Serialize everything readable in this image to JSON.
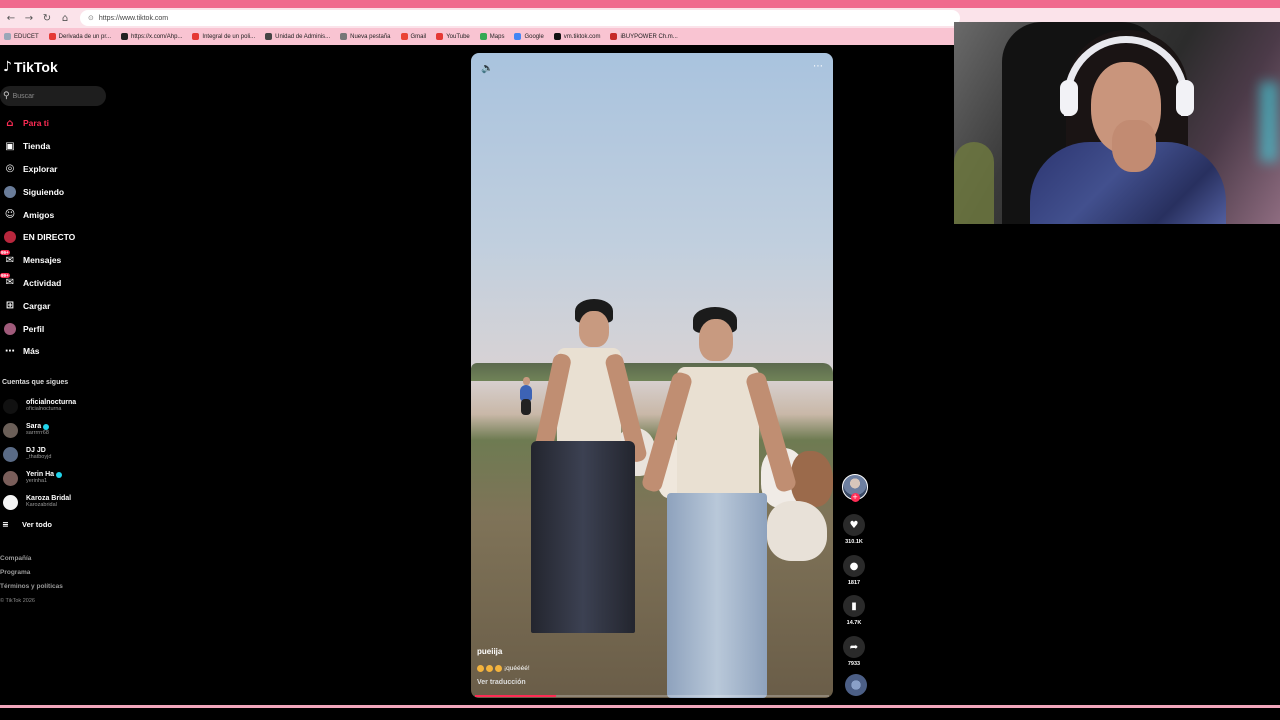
{
  "browser": {
    "url": "https://www.tiktok.com",
    "bookmarks": [
      {
        "label": "EDUCET",
        "color": "#9aa7b8"
      },
      {
        "label": "Derivada de un pr...",
        "color": "#e53935"
      },
      {
        "label": "https://x.com/Ahp...",
        "color": "#222222"
      },
      {
        "label": "Integral de un poli...",
        "color": "#e53935"
      },
      {
        "label": "Unidad de Adminis...",
        "color": "#444444"
      },
      {
        "label": "Nueva pestaña",
        "color": "#777777"
      },
      {
        "label": "Gmail",
        "color": "#ea4335"
      },
      {
        "label": "YouTube",
        "color": "#e53935"
      },
      {
        "label": "Maps",
        "color": "#34a853"
      },
      {
        "label": "Google",
        "color": "#4285f4"
      },
      {
        "label": "vm.tiktok.com",
        "color": "#111111"
      },
      {
        "label": "iBUYPOWER Ch.m...",
        "color": "#c62828"
      }
    ]
  },
  "brand": {
    "name": "TikTok",
    "accent": "#fe2c55"
  },
  "search": {
    "placeholder": "Buscar"
  },
  "menu": [
    {
      "label": "Para ti",
      "icon": "home-icon",
      "active": true
    },
    {
      "label": "Tienda",
      "icon": "shop-icon"
    },
    {
      "label": "Explorar",
      "icon": "compass-icon"
    },
    {
      "label": "Siguiendo",
      "icon": "following-avatar-icon"
    },
    {
      "label": "Amigos",
      "icon": "friends-icon"
    },
    {
      "label": "EN DIRECTO",
      "icon": "live-icon"
    },
    {
      "label": "Mensajes",
      "icon": "messages-icon",
      "badge": "99+"
    },
    {
      "label": "Actividad",
      "icon": "activity-icon",
      "badge": "99+"
    },
    {
      "label": "Cargar",
      "icon": "upload-icon"
    },
    {
      "label": "Perfil",
      "icon": "profile-avatar-icon"
    },
    {
      "label": "Más",
      "icon": "more-icon"
    }
  ],
  "following": {
    "title": "Cuentas que sigues",
    "accounts": [
      {
        "name": "oficialnocturna",
        "username": "oficialnocturna",
        "verified": false,
        "color": "#111111"
      },
      {
        "name": "Sara",
        "username": "sarrrrrr68",
        "verified": true,
        "color": "#6b5f58"
      },
      {
        "name": "DJ JD",
        "username": "_thatboyjd",
        "verified": false,
        "color": "#5a6b86"
      },
      {
        "name": "Yerin Ha",
        "username": "yerinha1",
        "verified": true,
        "color": "#7a5e5a"
      },
      {
        "name": "Karoza Bridal",
        "username": "Karozabridal",
        "verified": false,
        "color": "#f5f5f5"
      }
    ],
    "see_all": "Ver todo"
  },
  "footer": {
    "links": [
      "Compañía",
      "Programa",
      "Términos y políticas"
    ],
    "copyright": "© TikTok 2026"
  },
  "video": {
    "author": "pueiija",
    "caption": "¡quéééé!",
    "translate": "Ver traducción",
    "progress": 0.23
  },
  "actions": {
    "likes": "310.1K",
    "comments": "1817",
    "saves": "14.7K",
    "shares": "7933"
  }
}
